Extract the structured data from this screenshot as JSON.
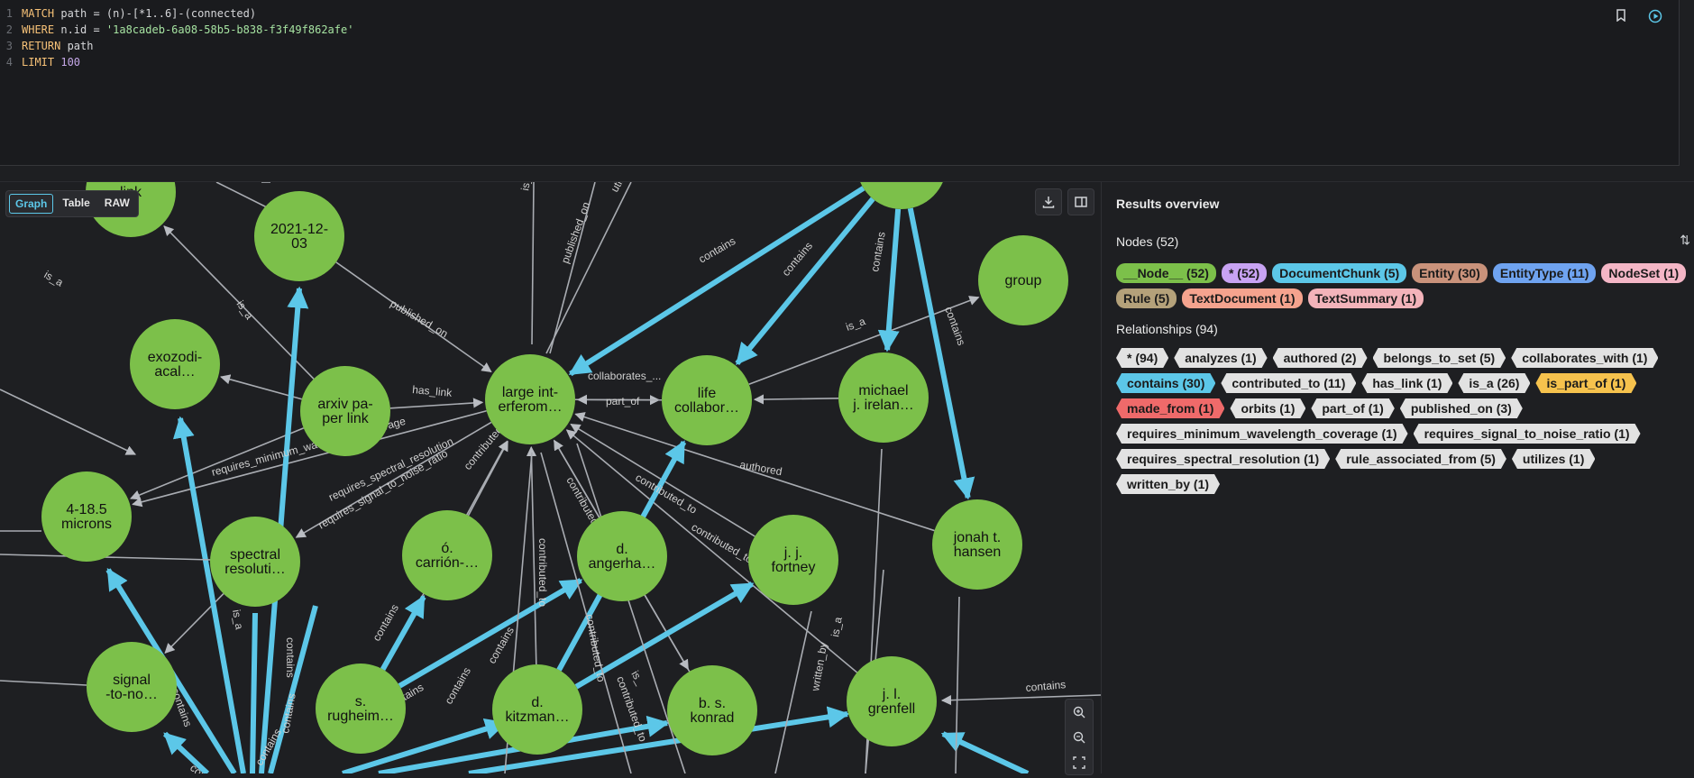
{
  "query": {
    "lines": [
      {
        "num": "1",
        "parts": [
          {
            "t": "MATCH",
            "c": "kw"
          },
          {
            "t": " path = (n)-[*1..6]-(connected)",
            "c": "id"
          }
        ]
      },
      {
        "num": "2",
        "parts": [
          {
            "t": "WHERE",
            "c": "kw"
          },
          {
            "t": " n.id = ",
            "c": "id"
          },
          {
            "t": "'1a8cadeb-6a08-58b5-b838-f3f49f862afe'",
            "c": "str"
          }
        ]
      },
      {
        "num": "3",
        "parts": [
          {
            "t": "RETURN",
            "c": "kw"
          },
          {
            "t": " path",
            "c": "id"
          }
        ]
      },
      {
        "num": "4",
        "parts": [
          {
            "t": "LIMIT",
            "c": "kw"
          },
          {
            "t": " ",
            "c": "id"
          },
          {
            "t": "100",
            "c": "num"
          }
        ]
      }
    ]
  },
  "view_tabs": [
    "Graph",
    "Table",
    "RAW"
  ],
  "results": {
    "title": "Results overview",
    "nodes_heading": "Nodes (52)",
    "node_chips": [
      {
        "label": "__Node__ (52)",
        "color": "#7cc04a"
      },
      {
        "label": "* (52)",
        "color": "#c8a3f3"
      },
      {
        "label": "DocumentChunk (5)",
        "color": "#5cc7e8"
      },
      {
        "label": "Entity (30)",
        "color": "#c9927b"
      },
      {
        "label": "EntityType (11)",
        "color": "#6fa3f0"
      },
      {
        "label": "NodeSet (1)",
        "color": "#f4b6c6"
      },
      {
        "label": "Rule (5)",
        "color": "#b4a17a"
      },
      {
        "label": "TextDocument (1)",
        "color": "#f5a38e"
      },
      {
        "label": "TextSummary (1)",
        "color": "#f3b3ba"
      }
    ],
    "rels_heading": "Relationships (94)",
    "rel_chips": [
      {
        "label": "* (94)",
        "color": "#e2e2e2"
      },
      {
        "label": "analyzes (1)",
        "color": "#e2e2e2"
      },
      {
        "label": "authored (2)",
        "color": "#e2e2e2"
      },
      {
        "label": "belongs_to_set (5)",
        "color": "#e2e2e2"
      },
      {
        "label": "collaborates_with (1)",
        "color": "#e2e2e2"
      },
      {
        "label": "contains (30)",
        "color": "#5cc7e8"
      },
      {
        "label": "contributed_to (11)",
        "color": "#e2e2e2"
      },
      {
        "label": "has_link (1)",
        "color": "#e2e2e2"
      },
      {
        "label": "is_a (26)",
        "color": "#e2e2e2"
      },
      {
        "label": "is_part_of (1)",
        "color": "#f6c24d"
      },
      {
        "label": "made_from (1)",
        "color": "#ef6a6a"
      },
      {
        "label": "orbits (1)",
        "color": "#e2e2e2"
      },
      {
        "label": "part_of (1)",
        "color": "#e2e2e2"
      },
      {
        "label": "published_on (3)",
        "color": "#e2e2e2"
      },
      {
        "label": "requires_minimum_wavelength_coverage (1)",
        "color": "#e2e2e2"
      },
      {
        "label": "requires_signal_to_noise_ratio (1)",
        "color": "#e2e2e2"
      },
      {
        "label": "requires_spectral_resolution (1)",
        "color": "#e2e2e2"
      },
      {
        "label": "rule_associated_from (5)",
        "color": "#e2e2e2"
      },
      {
        "label": "utilizes (1)",
        "color": "#e2e2e2"
      },
      {
        "label": "written_by (1)",
        "color": "#e2e2e2"
      }
    ]
  },
  "graph": {
    "node_color": "#7cc04a",
    "nodes": [
      {
        "id": "link",
        "lines": [
          "link"
        ]
      },
      {
        "id": "d2021",
        "lines": [
          "2021-12-",
          "03"
        ]
      },
      {
        "id": "top",
        "lines": [
          ""
        ]
      },
      {
        "id": "group",
        "lines": [
          "group"
        ]
      },
      {
        "id": "exo",
        "lines": [
          "exozodi-",
          "acal…"
        ]
      },
      {
        "id": "arxiv",
        "lines": [
          "arxiv pa-",
          "per link"
        ]
      },
      {
        "id": "large",
        "lines": [
          "large int-",
          "erferom…"
        ]
      },
      {
        "id": "life",
        "lines": [
          "life",
          "collabor…"
        ]
      },
      {
        "id": "irelan",
        "lines": [
          "michael",
          "j. irelan…"
        ]
      },
      {
        "id": "microns",
        "lines": [
          "4-18.5",
          "microns"
        ]
      },
      {
        "id": "spectral",
        "lines": [
          "spectral",
          "resoluti…"
        ]
      },
      {
        "id": "carrion",
        "lines": [
          "ó.",
          "carrión-…"
        ]
      },
      {
        "id": "angerha",
        "lines": [
          "d.",
          "angerha…"
        ]
      },
      {
        "id": "fortney",
        "lines": [
          "j. j.",
          "fortney"
        ]
      },
      {
        "id": "hansen",
        "lines": [
          "jonah t.",
          "hansen"
        ]
      },
      {
        "id": "signal",
        "lines": [
          "signal",
          "-to-no…"
        ]
      },
      {
        "id": "rugheim",
        "lines": [
          "s.",
          "rugheim…"
        ]
      },
      {
        "id": "kitzman",
        "lines": [
          "d.",
          "kitzman…"
        ]
      },
      {
        "id": "konrad",
        "lines": [
          "b. s.",
          "konrad"
        ]
      },
      {
        "id": "grenfell",
        "lines": [
          "j. l.",
          "grenfell"
        ]
      }
    ],
    "edge_labels": [
      "is_a",
      "is_a",
      "published_on",
      "published_on",
      "utiliz",
      "is_",
      "contains",
      "contains",
      "contains",
      "contains",
      "is_a",
      "has_link",
      "collaborates_...",
      "part_of",
      "requires_minimum_wavelength_coverage",
      "requires_spectral_resolution",
      "requires_signal_to_noise_ratio",
      "contributed_to",
      "contributed_to",
      "contributed_to",
      "contributed_to",
      "authored",
      "contains",
      "contains",
      "contains",
      "contains",
      "contributed_to",
      "contributed_to",
      "contributed_to",
      "contains",
      "is_a",
      "is_a",
      "is_",
      "written_by",
      "contains",
      "contains",
      "contains",
      "contains",
      "con"
    ]
  }
}
